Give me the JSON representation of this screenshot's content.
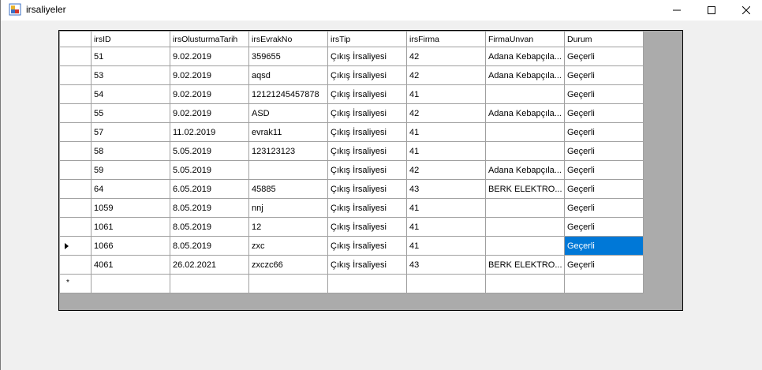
{
  "window": {
    "title": "irsaliyeler"
  },
  "grid": {
    "columns": [
      "irsID",
      "irsOlusturmaTarih",
      "irsEvrakNo",
      "irsTip",
      "irsFirma",
      "FirmaUnvan",
      "Durum"
    ],
    "rows": [
      [
        "51",
        "9.02.2019",
        "359655",
        "Çıkış İrsaliyesi",
        "42",
        "Adana Kebapçıla...",
        "Geçerli"
      ],
      [
        "53",
        "9.02.2019",
        "aqsd",
        "Çıkış İrsaliyesi",
        "42",
        "Adana Kebapçıla...",
        "Geçerli"
      ],
      [
        "54",
        "9.02.2019",
        "12121245457878",
        "Çıkış İrsaliyesi",
        "41",
        "",
        "Geçerli"
      ],
      [
        "55",
        "9.02.2019",
        "ASD",
        "Çıkış İrsaliyesi",
        "42",
        "Adana Kebapçıla...",
        "Geçerli"
      ],
      [
        "57",
        "11.02.2019",
        "evrak11",
        "Çıkış İrsaliyesi",
        "41",
        "",
        "Geçerli"
      ],
      [
        "58",
        "5.05.2019",
        "123123123",
        "Çıkış İrsaliyesi",
        "41",
        "",
        "Geçerli"
      ],
      [
        "59",
        "5.05.2019",
        "",
        "Çıkış İrsaliyesi",
        "42",
        "Adana Kebapçıla...",
        "Geçerli"
      ],
      [
        "64",
        "6.05.2019",
        "45885",
        "Çıkış İrsaliyesi",
        "43",
        "BERK ELEKTRO...",
        "Geçerli"
      ],
      [
        "1059",
        "8.05.2019",
        "nnj",
        "Çıkış İrsaliyesi",
        "41",
        "",
        "Geçerli"
      ],
      [
        "1061",
        "8.05.2019",
        "12",
        "Çıkış İrsaliyesi",
        "41",
        "",
        "Geçerli"
      ],
      [
        "1066",
        "8.05.2019",
        "zxc",
        "Çıkış İrsaliyesi",
        "41",
        "",
        "Geçerli"
      ],
      [
        "4061",
        "26.02.2021",
        "zxczc66",
        "Çıkış İrsaliyesi",
        "43",
        "BERK ELEKTRO...",
        "Geçerli"
      ]
    ],
    "current_row_index": 10,
    "selected_column_index": 6,
    "new_row_marker": "*",
    "selection_color": "#0078d7"
  }
}
